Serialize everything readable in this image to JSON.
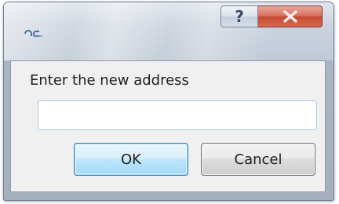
{
  "window": {
    "icon": "app-logo-icon",
    "help_label": "?",
    "close_icon": "close-icon"
  },
  "dialog": {
    "prompt": "Enter the new address",
    "input_value": "",
    "ok_label": "OK",
    "cancel_label": "Cancel"
  },
  "colors": {
    "close_button": "#c64a34",
    "ok_border": "#3c7fb1"
  }
}
